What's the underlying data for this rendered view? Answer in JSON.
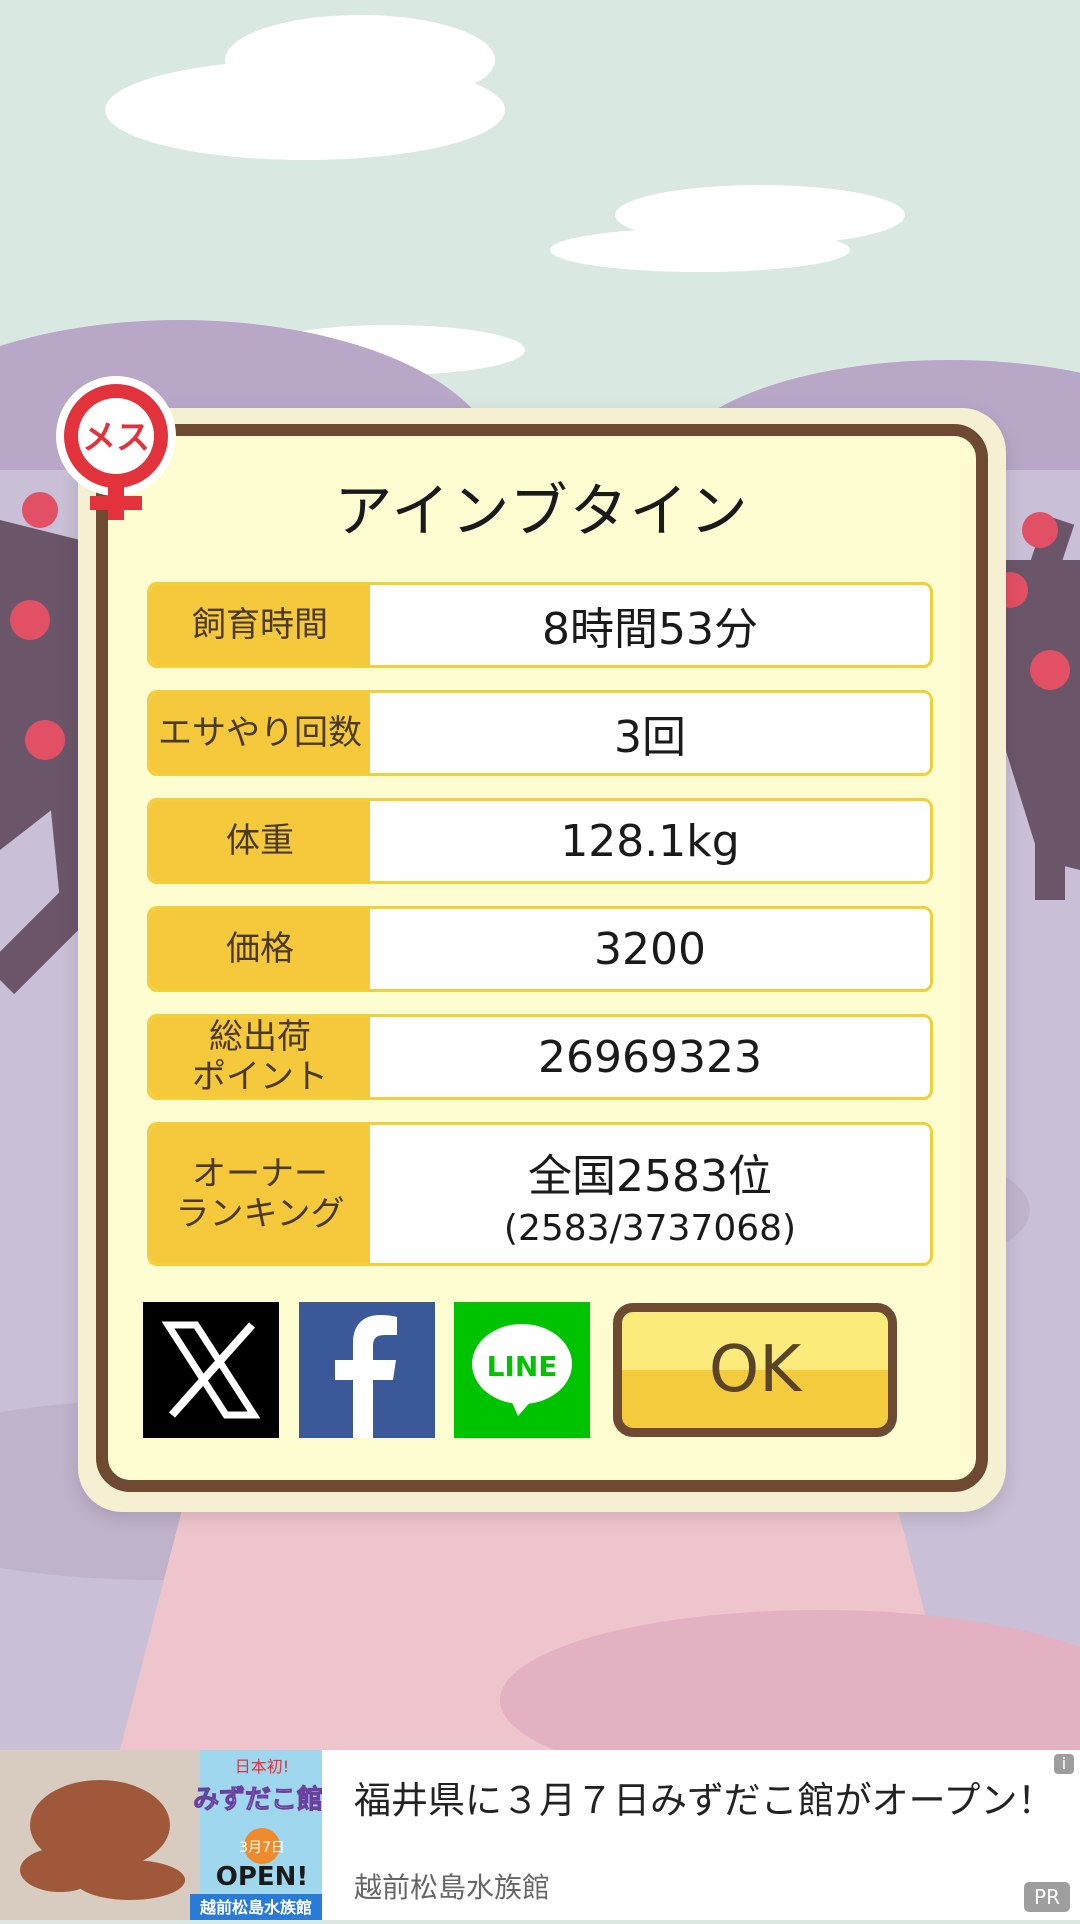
{
  "badge": {
    "text": "メス",
    "icon": "female-symbol-icon"
  },
  "animal_name": "アインブタイン",
  "stats": [
    {
      "label": "飼育時間",
      "value": "8時間53分"
    },
    {
      "label": "エサやり回数",
      "value": "3回"
    },
    {
      "label": "体重",
      "value": "128.1kg"
    },
    {
      "label": "価格",
      "value": "3200"
    },
    {
      "label": "総出荷\nポイント",
      "value": "26969323"
    },
    {
      "label": "オーナー\nランキング",
      "value": "全国2583位",
      "sub": "(2583/3737068)"
    }
  ],
  "share": {
    "x_icon": "x-logo-icon",
    "facebook_icon": "facebook-logo-icon",
    "line_label": "LINE"
  },
  "ok_label": "OK",
  "ad": {
    "image_texts": {
      "line1": "日本初!",
      "line2": "みずだこ館",
      "date": "3月7日",
      "open": "OPEN!",
      "name": "越前松島水族館"
    },
    "headline": "福井県に３月７日みずだこ館がオープン！",
    "source": "越前松島水族館",
    "info": "i",
    "pr": "PR"
  },
  "colors": {
    "frame": "#6e4a33",
    "panel": "#fefdd1",
    "label_bg": "#f6c93c",
    "badge_red": "#e2323c",
    "line_green": "#00c300",
    "facebook_blue": "#3b5998"
  }
}
